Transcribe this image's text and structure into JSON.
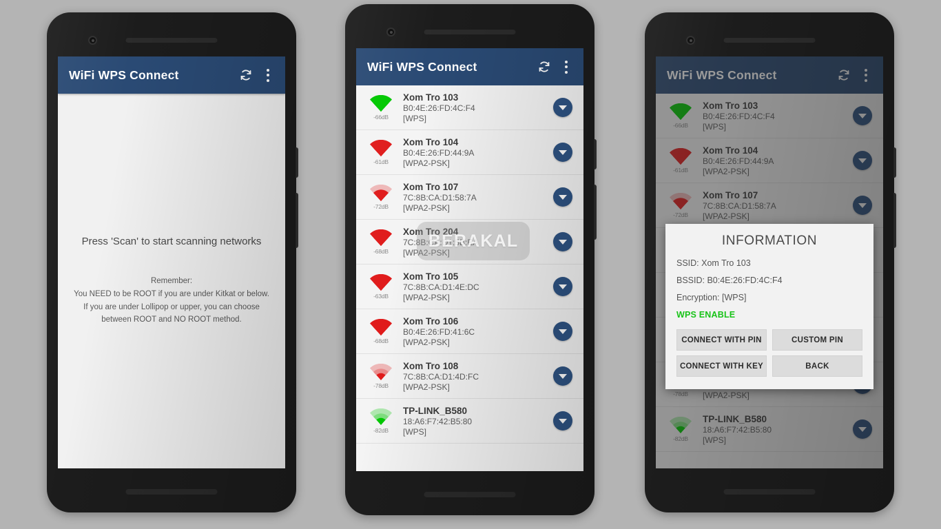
{
  "app": {
    "title": "WiFi WPS Connect",
    "refresh_icon": "refresh-icon",
    "overflow_icon": "overflow-menu-icon",
    "appbar_color": "#2a4a74"
  },
  "empty_state": {
    "headline": "Press 'Scan' to start scanning networks",
    "remember_label": "Remember:",
    "remember_line1": "You NEED to be ROOT if you are under Kitkat or below.",
    "remember_line2": "If you are under Lollipop or upper, you can choose",
    "remember_line3": "between ROOT and NO ROOT method."
  },
  "watermark": {
    "text": "BERAKAL"
  },
  "networks": [
    {
      "ssid": "Xom Tro 103",
      "bssid": "B0:4E:26:FD:4C:F4",
      "encryption": "[WPS]",
      "signal": "-66dB",
      "signal_color": "#00c800",
      "strength": 3
    },
    {
      "ssid": "Xom Tro 104",
      "bssid": "B0:4E:26:FD:44:9A",
      "encryption": "[WPA2-PSK]",
      "signal": "-61dB",
      "signal_color": "#e01b1b",
      "strength": 3
    },
    {
      "ssid": "Xom Tro 107",
      "bssid": "7C:8B:CA:D1:58:7A",
      "encryption": "[WPA2-PSK]",
      "signal": "-72dB",
      "signal_color": "#e01b1b",
      "strength": 2
    },
    {
      "ssid": "Xom Tro 204",
      "bssid": "7C:8B:CA:D1:5B:EA",
      "encryption": "[WPA2-PSK]",
      "signal": "-68dB",
      "signal_color": "#e01b1b",
      "strength": 3
    },
    {
      "ssid": "Xom Tro 105",
      "bssid": "7C:8B:CA:D1:4E:DC",
      "encryption": "[WPA2-PSK]",
      "signal": "-63dB",
      "signal_color": "#e01b1b",
      "strength": 3
    },
    {
      "ssid": "Xom Tro 106",
      "bssid": "B0:4E:26:FD:41:6C",
      "encryption": "[WPA2-PSK]",
      "signal": "-68dB",
      "signal_color": "#e01b1b",
      "strength": 3
    },
    {
      "ssid": "Xom Tro 108",
      "bssid": "7C:8B:CA:D1:4D:FC",
      "encryption": "[WPA2-PSK]",
      "signal": "-78dB",
      "signal_color": "#e01b1b",
      "strength": 1
    },
    {
      "ssid": "TP-LINK_B580",
      "bssid": "18:A6:F7:42:B5:80",
      "encryption": "[WPS]",
      "signal": "-82dB",
      "signal_color": "#00c800",
      "strength": 1
    }
  ],
  "dialog": {
    "title": "INFORMATION",
    "ssid_line": "SSID: Xom Tro 103",
    "bssid_line": "BSSID: B0:4E:26:FD:4C:F4",
    "encryption_line": "Encryption: [WPS]",
    "wps_status": "WPS ENABLE",
    "wps_status_color": "#18c318",
    "buttons": [
      "CONNECT WITH PIN",
      "CUSTOM PIN",
      "CONNECT WITH KEY",
      "BACK"
    ]
  }
}
